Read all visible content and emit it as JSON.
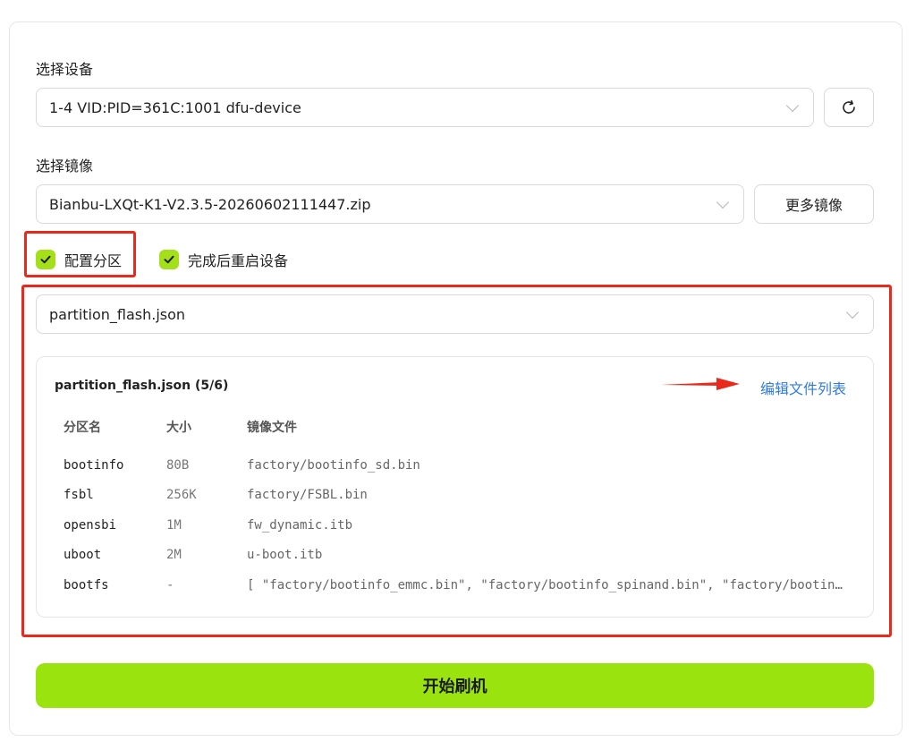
{
  "device": {
    "label": "选择设备",
    "selected": "1-4 VID:PID=361C:1001 dfu-device"
  },
  "image": {
    "label": "选择镜像",
    "selected": "Bianbu-LXQt-K1-V2.3.5-20260602111447.zip",
    "more_button": "更多镜像"
  },
  "options": {
    "partition_label": "配置分区",
    "partition_checked": true,
    "reboot_label": "完成后重启设备",
    "reboot_checked": true
  },
  "partition_file": {
    "selected": "partition_flash.json"
  },
  "partition_panel": {
    "title": "partition_flash.json (5/6)",
    "edit_link": "编辑文件列表",
    "headers": {
      "name": "分区名",
      "size": "大小",
      "file": "镜像文件"
    },
    "rows": [
      {
        "name": "bootinfo",
        "size": "80B",
        "file": "factory/bootinfo_sd.bin"
      },
      {
        "name": "fsbl",
        "size": "256K",
        "file": "factory/FSBL.bin"
      },
      {
        "name": "opensbi",
        "size": "1M",
        "file": "fw_dynamic.itb"
      },
      {
        "name": "uboot",
        "size": "2M",
        "file": "u-boot.itb"
      },
      {
        "name": "bootfs",
        "size": "-",
        "file": "[ \"factory/bootinfo_emmc.bin\", \"factory/bootinfo_spinand.bin\", \"factory/bootinfo_spinor.bin\" ]"
      }
    ]
  },
  "start_button": "开始刷机",
  "colors": {
    "accent": "#9ae30e",
    "checkbox": "#a3e01a",
    "highlight": "#e8291c",
    "link": "#2f7be0"
  },
  "icons": {
    "refresh": "refresh-icon",
    "chevron": "chevron-down-icon",
    "check": "check-icon",
    "arrow": "arrow-right-icon"
  }
}
